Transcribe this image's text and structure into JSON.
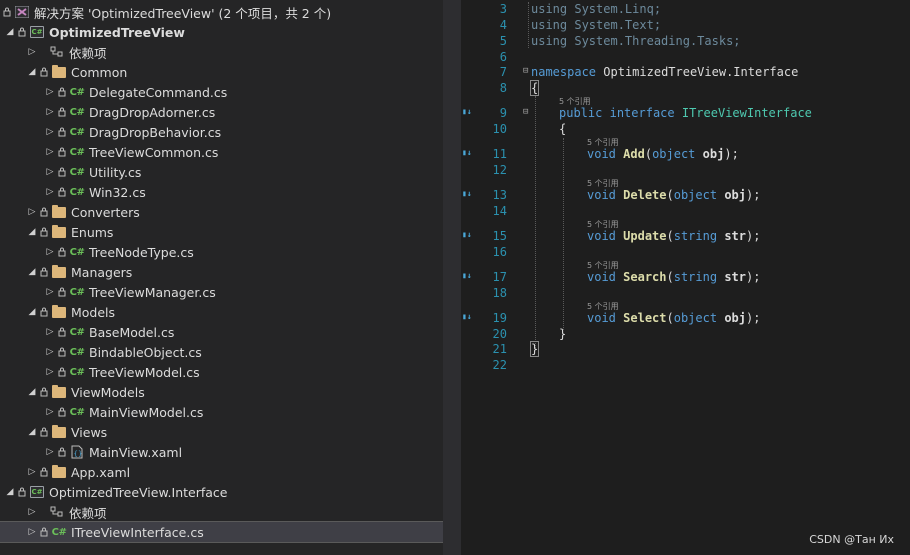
{
  "explorer": {
    "solution": "解决方案 'OptimizedTreeView' (2 个项目，共 2 个)",
    "project1": {
      "name": "OptimizedTreeView",
      "dependencies": "依赖项",
      "common": {
        "name": "Common",
        "files": [
          "DelegateCommand.cs",
          "DragDropAdorner.cs",
          "DragDropBehavior.cs",
          "TreeViewCommon.cs",
          "Utility.cs",
          "Win32.cs"
        ]
      },
      "converters": "Converters",
      "enums": {
        "name": "Enums",
        "files": [
          "TreeNodeType.cs"
        ]
      },
      "managers": {
        "name": "Managers",
        "files": [
          "TreeViewManager.cs"
        ]
      },
      "models": {
        "name": "Models",
        "files": [
          "BaseModel.cs",
          "BindableObject.cs",
          "TreeViewModel.cs"
        ]
      },
      "viewmodels": {
        "name": "ViewModels",
        "files": [
          "MainViewModel.cs"
        ]
      },
      "views": {
        "name": "Views",
        "files": [
          "MainView.xaml"
        ]
      },
      "app": "App.xaml"
    },
    "project2": {
      "name": "OptimizedTreeView.Interface",
      "dependencies": "依赖项",
      "file": "ITreeViewInterface.cs"
    },
    "cs_badge": "C#"
  },
  "editor": {
    "line_numbers": [
      "3",
      "4",
      "5",
      "6",
      "7",
      "8",
      "9",
      "10",
      "11",
      "12",
      "13",
      "14",
      "15",
      "16",
      "17",
      "18",
      "19",
      "20",
      "21",
      "22"
    ],
    "ref_lens": "5 个引用",
    "tokens": {
      "using": "using",
      "linq": "System.Linq;",
      "text": "System.Text;",
      "tasks": "System.Threading.Tasks;",
      "namespace": "namespace",
      "ns_name": "OptimizedTreeView.Interface",
      "open_brace": "{",
      "close_brace": "}",
      "public": "public",
      "interface": "interface",
      "iface_name": "ITreeViewInterface",
      "void": "void",
      "object": "object",
      "string": "string",
      "obj": "obj",
      "str": "str",
      "add": "Add",
      "delete": "Delete",
      "update": "Update",
      "search": "Search",
      "select": "Select",
      "lparen": "(",
      "rparen_semi": ");"
    }
  },
  "watermark": "CSDN @Тан Их"
}
